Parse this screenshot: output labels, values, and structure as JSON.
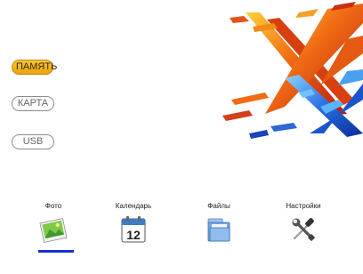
{
  "sources": [
    {
      "label": "ПАМЯТЬ",
      "state": "selected"
    },
    {
      "label": "КАРТА",
      "state": "unselected"
    },
    {
      "label": "USB",
      "state": "unselected"
    }
  ],
  "apps": [
    {
      "label": "Фото",
      "icon": "photo-icon",
      "selected": true
    },
    {
      "label": "Календарь",
      "icon": "calendar-icon",
      "day": "12"
    },
    {
      "label": "Файлы",
      "icon": "folder-icon"
    },
    {
      "label": "Настройки",
      "icon": "settings-tools-icon"
    }
  ],
  "colors": {
    "accent": "#1432d4",
    "active_pill": "#f0b722"
  }
}
